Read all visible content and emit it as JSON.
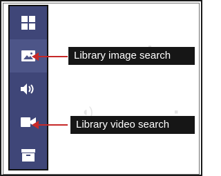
{
  "sidebar": {
    "items": [
      {
        "icon": "grid-icon"
      },
      {
        "icon": "image-icon"
      },
      {
        "icon": "speaker-icon"
      },
      {
        "icon": "video-camera-icon"
      },
      {
        "icon": "archive-box-icon"
      }
    ],
    "background": "#3f4678",
    "active_background": "#4d5588"
  },
  "callouts": {
    "image_search": "Library image search",
    "video_search": "Library video search"
  },
  "colors": {
    "arrow": "#c62828",
    "callout_bg": "#161616"
  }
}
